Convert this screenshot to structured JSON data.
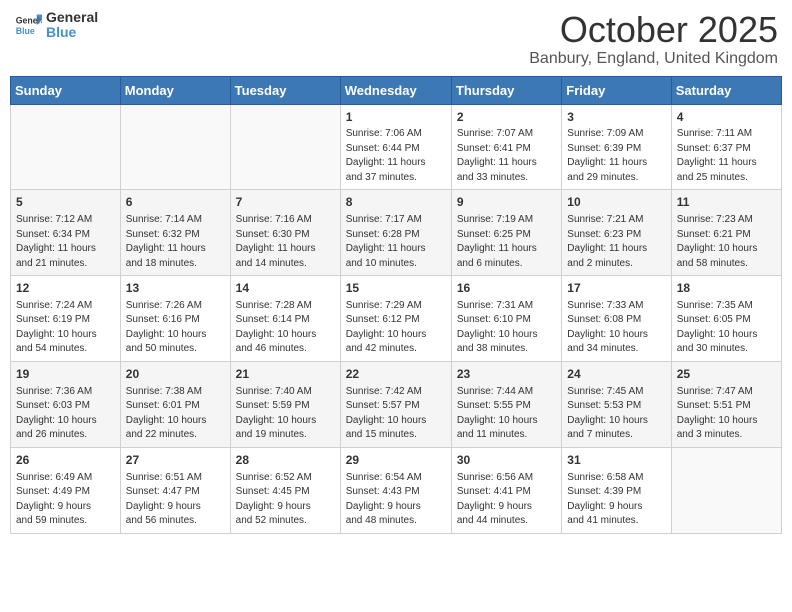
{
  "header": {
    "logo_general": "General",
    "logo_blue": "Blue",
    "month_title": "October 2025",
    "location": "Banbury, England, United Kingdom"
  },
  "days_of_week": [
    "Sunday",
    "Monday",
    "Tuesday",
    "Wednesday",
    "Thursday",
    "Friday",
    "Saturday"
  ],
  "weeks": [
    {
      "days": [
        {
          "number": "",
          "info": ""
        },
        {
          "number": "",
          "info": ""
        },
        {
          "number": "",
          "info": ""
        },
        {
          "number": "1",
          "info": "Sunrise: 7:06 AM\nSunset: 6:44 PM\nDaylight: 11 hours\nand 37 minutes."
        },
        {
          "number": "2",
          "info": "Sunrise: 7:07 AM\nSunset: 6:41 PM\nDaylight: 11 hours\nand 33 minutes."
        },
        {
          "number": "3",
          "info": "Sunrise: 7:09 AM\nSunset: 6:39 PM\nDaylight: 11 hours\nand 29 minutes."
        },
        {
          "number": "4",
          "info": "Sunrise: 7:11 AM\nSunset: 6:37 PM\nDaylight: 11 hours\nand 25 minutes."
        }
      ]
    },
    {
      "days": [
        {
          "number": "5",
          "info": "Sunrise: 7:12 AM\nSunset: 6:34 PM\nDaylight: 11 hours\nand 21 minutes."
        },
        {
          "number": "6",
          "info": "Sunrise: 7:14 AM\nSunset: 6:32 PM\nDaylight: 11 hours\nand 18 minutes."
        },
        {
          "number": "7",
          "info": "Sunrise: 7:16 AM\nSunset: 6:30 PM\nDaylight: 11 hours\nand 14 minutes."
        },
        {
          "number": "8",
          "info": "Sunrise: 7:17 AM\nSunset: 6:28 PM\nDaylight: 11 hours\nand 10 minutes."
        },
        {
          "number": "9",
          "info": "Sunrise: 7:19 AM\nSunset: 6:25 PM\nDaylight: 11 hours\nand 6 minutes."
        },
        {
          "number": "10",
          "info": "Sunrise: 7:21 AM\nSunset: 6:23 PM\nDaylight: 11 hours\nand 2 minutes."
        },
        {
          "number": "11",
          "info": "Sunrise: 7:23 AM\nSunset: 6:21 PM\nDaylight: 10 hours\nand 58 minutes."
        }
      ]
    },
    {
      "days": [
        {
          "number": "12",
          "info": "Sunrise: 7:24 AM\nSunset: 6:19 PM\nDaylight: 10 hours\nand 54 minutes."
        },
        {
          "number": "13",
          "info": "Sunrise: 7:26 AM\nSunset: 6:16 PM\nDaylight: 10 hours\nand 50 minutes."
        },
        {
          "number": "14",
          "info": "Sunrise: 7:28 AM\nSunset: 6:14 PM\nDaylight: 10 hours\nand 46 minutes."
        },
        {
          "number": "15",
          "info": "Sunrise: 7:29 AM\nSunset: 6:12 PM\nDaylight: 10 hours\nand 42 minutes."
        },
        {
          "number": "16",
          "info": "Sunrise: 7:31 AM\nSunset: 6:10 PM\nDaylight: 10 hours\nand 38 minutes."
        },
        {
          "number": "17",
          "info": "Sunrise: 7:33 AM\nSunset: 6:08 PM\nDaylight: 10 hours\nand 34 minutes."
        },
        {
          "number": "18",
          "info": "Sunrise: 7:35 AM\nSunset: 6:05 PM\nDaylight: 10 hours\nand 30 minutes."
        }
      ]
    },
    {
      "days": [
        {
          "number": "19",
          "info": "Sunrise: 7:36 AM\nSunset: 6:03 PM\nDaylight: 10 hours\nand 26 minutes."
        },
        {
          "number": "20",
          "info": "Sunrise: 7:38 AM\nSunset: 6:01 PM\nDaylight: 10 hours\nand 22 minutes."
        },
        {
          "number": "21",
          "info": "Sunrise: 7:40 AM\nSunset: 5:59 PM\nDaylight: 10 hours\nand 19 minutes."
        },
        {
          "number": "22",
          "info": "Sunrise: 7:42 AM\nSunset: 5:57 PM\nDaylight: 10 hours\nand 15 minutes."
        },
        {
          "number": "23",
          "info": "Sunrise: 7:44 AM\nSunset: 5:55 PM\nDaylight: 10 hours\nand 11 minutes."
        },
        {
          "number": "24",
          "info": "Sunrise: 7:45 AM\nSunset: 5:53 PM\nDaylight: 10 hours\nand 7 minutes."
        },
        {
          "number": "25",
          "info": "Sunrise: 7:47 AM\nSunset: 5:51 PM\nDaylight: 10 hours\nand 3 minutes."
        }
      ]
    },
    {
      "days": [
        {
          "number": "26",
          "info": "Sunrise: 6:49 AM\nSunset: 4:49 PM\nDaylight: 9 hours\nand 59 minutes."
        },
        {
          "number": "27",
          "info": "Sunrise: 6:51 AM\nSunset: 4:47 PM\nDaylight: 9 hours\nand 56 minutes."
        },
        {
          "number": "28",
          "info": "Sunrise: 6:52 AM\nSunset: 4:45 PM\nDaylight: 9 hours\nand 52 minutes."
        },
        {
          "number": "29",
          "info": "Sunrise: 6:54 AM\nSunset: 4:43 PM\nDaylight: 9 hours\nand 48 minutes."
        },
        {
          "number": "30",
          "info": "Sunrise: 6:56 AM\nSunset: 4:41 PM\nDaylight: 9 hours\nand 44 minutes."
        },
        {
          "number": "31",
          "info": "Sunrise: 6:58 AM\nSunset: 4:39 PM\nDaylight: 9 hours\nand 41 minutes."
        },
        {
          "number": "",
          "info": ""
        }
      ]
    }
  ]
}
